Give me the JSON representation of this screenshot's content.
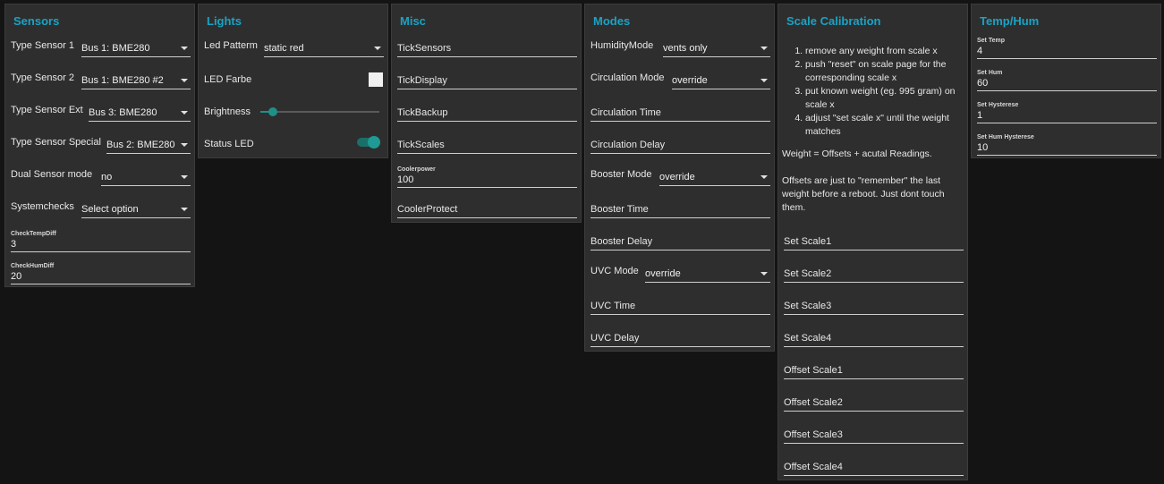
{
  "sensors": {
    "title": "Sensors",
    "selects": [
      {
        "label": "Type Sensor 1",
        "value": "Bus 1: BME280"
      },
      {
        "label": "Type Sensor 2",
        "value": "Bus 1: BME280 #2"
      },
      {
        "label": "Type Sensor Ext",
        "value": "Bus 3: BME280"
      },
      {
        "label": "Type Sensor Special",
        "value": "Bus 2: BME280"
      },
      {
        "label": "Dual Sensor mode",
        "value": "no"
      },
      {
        "label": "Systemchecks",
        "value": "Select option"
      }
    ],
    "fields": [
      {
        "label": "CheckTempDiff",
        "value": "3"
      },
      {
        "label": "CheckHumDiff",
        "value": "20"
      }
    ]
  },
  "lights": {
    "title": "Lights",
    "pattern_label": "Led Patterm",
    "pattern_value": "static red",
    "color_label": "LED Farbe",
    "color_value": "#f0f0f0",
    "brightness_label": "Brightness",
    "brightness_level": 0.07,
    "status_label": "Status LED",
    "status_on": true,
    "accent": "#1f8f8a"
  },
  "misc": {
    "title": "Misc",
    "fields": [
      "TickSensors",
      "TickDisplay",
      "TickBackup",
      "TickScales"
    ],
    "cooler_label": "Coolerpower",
    "cooler_value": "100",
    "protect": "CoolerProtect"
  },
  "modes": {
    "title": "Modes",
    "humidity_label": "HumidityMode",
    "humidity_value": "vents only",
    "circ_label": "Circulation Mode",
    "circ_value": "override",
    "circ_time": "Circulation Time",
    "circ_delay": "Circulation Delay",
    "booster_label": "Booster Mode",
    "booster_value": "override",
    "booster_time": "Booster Time",
    "booster_delay": "Booster Delay",
    "uvc_label": "UVC Mode",
    "uvc_value": "override",
    "uvc_time": "UVC Time",
    "uvc_delay": "UVC Delay"
  },
  "scale": {
    "title": "Scale Calibration",
    "steps": [
      "remove any weight from scale x",
      "push \"reset\" on scale page for the corresponding scale x",
      "put known weight (eg. 995 gram) on scale x",
      "adjust \"set scale x\" until the weight matches"
    ],
    "note1": "Weight = Offsets + acutal Readings.",
    "note2": "Offsets are just to \"remember\" the last weight before a reboot. Just dont touch them.",
    "fields": [
      "Set Scale1",
      "Set Scale2",
      "Set Scale3",
      "Set Scale4",
      "Offset Scale1",
      "Offset Scale2",
      "Offset Scale3",
      "Offset Scale4"
    ]
  },
  "temphum": {
    "title": "Temp/Hum",
    "fields": [
      {
        "label": "Set Temp",
        "value": "4"
      },
      {
        "label": "Set Hum",
        "value": "60"
      },
      {
        "label": "Set Hysterese",
        "value": "1"
      },
      {
        "label": "Set Hum Hysterese",
        "value": "10"
      }
    ]
  }
}
